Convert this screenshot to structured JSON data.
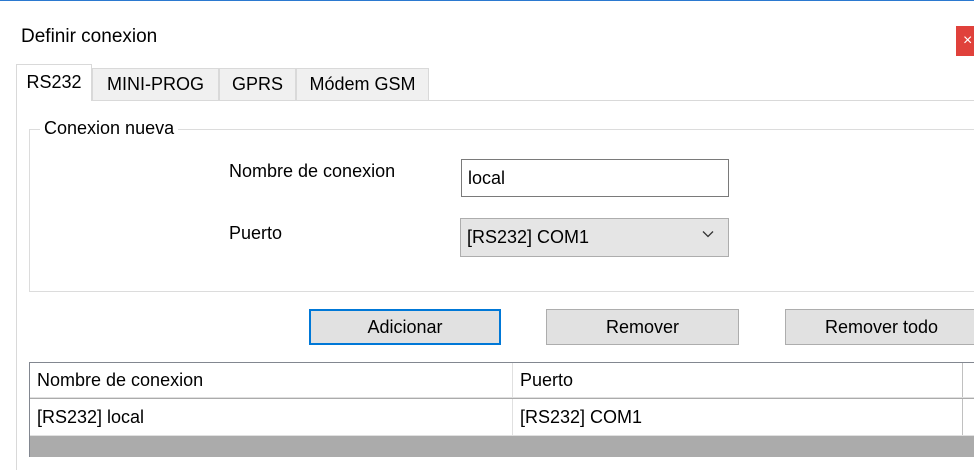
{
  "window": {
    "title": "Definir conexion",
    "close_glyph": "×"
  },
  "tabs": [
    {
      "label": "RS232",
      "active": true
    },
    {
      "label": "MINI-PROG",
      "active": false
    },
    {
      "label": "GPRS",
      "active": false
    },
    {
      "label": "Módem GSM",
      "active": false
    }
  ],
  "new_connection": {
    "group_label": "Conexion nueva",
    "name_label": "Nombre de conexion",
    "name_value": "local",
    "port_label": "Puerto",
    "port_selected": "[RS232] COM1",
    "port_arrow_icon": "chevron-down-icon"
  },
  "buttons": {
    "add": "Adicionar",
    "remove": "Remover",
    "remove_all": "Remover todo"
  },
  "grid": {
    "columns": [
      "Nombre de conexion",
      "Puerto"
    ],
    "rows": [
      [
        "[RS232] local",
        "[RS232] COM1"
      ]
    ]
  },
  "colors": {
    "accent": "#0078d7",
    "close_red": "#e0413b",
    "button_bg": "#e1e1e1",
    "grid_empty_bg": "#ababab"
  }
}
